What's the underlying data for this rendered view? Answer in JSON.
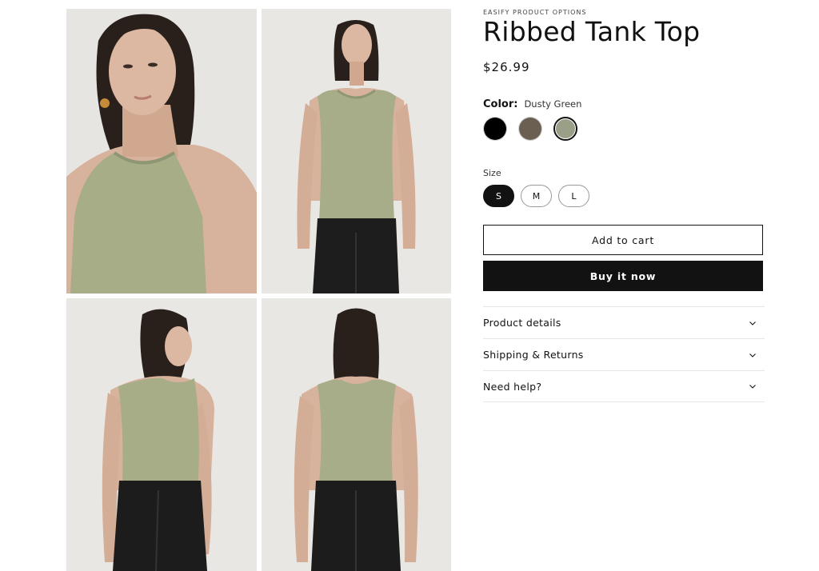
{
  "product": {
    "vendor": "EASIFY PRODUCT OPTIONS",
    "title": "Ribbed Tank Top",
    "price": "$26.99"
  },
  "color": {
    "label": "Color:",
    "selected_value": "Dusty Green",
    "swatches": [
      {
        "name": "Black",
        "hex": "#000000"
      },
      {
        "name": "Brown",
        "hex": "#6b5f52"
      },
      {
        "name": "Dusty Green",
        "hex": "#9aa088",
        "selected": true
      }
    ]
  },
  "size": {
    "label": "Size",
    "options": [
      "S",
      "M",
      "L"
    ],
    "selected": "S"
  },
  "buttons": {
    "add_to_cart": "Add to cart",
    "buy_now": "Buy it now"
  },
  "accordions": [
    {
      "label": "Product details",
      "icon": "chevron-down-icon"
    },
    {
      "label": "Shipping & Returns",
      "icon": "chevron-down-icon"
    },
    {
      "label": "Need help?",
      "icon": "chevron-down-icon"
    }
  ],
  "gallery": {
    "images": [
      "model-front-closeup",
      "model-front-full",
      "model-back-turned",
      "model-back-full"
    ],
    "colors": {
      "top": "#a7ad88",
      "skin": "#d8b39e",
      "hair": "#2b211c",
      "pants": "#1c1c1c",
      "background": "#e8e7e4"
    }
  }
}
